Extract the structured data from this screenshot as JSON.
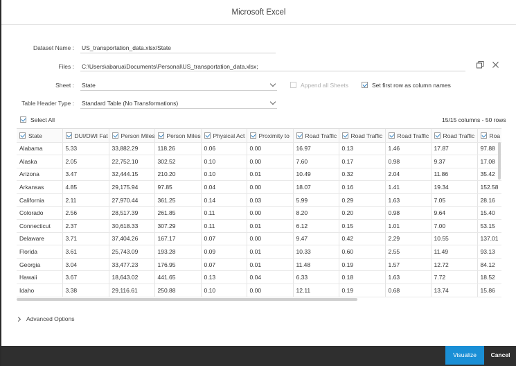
{
  "window": {
    "title": "Microsoft Excel"
  },
  "form": {
    "dataset_label": "Dataset Name :",
    "dataset_value": "US_transportation_data.xlsx/State",
    "files_label": "Files :",
    "files_value": "C:\\Users\\abarua\\Documents\\Personal\\US_transportation_data.xlsx;",
    "sheet_label": "Sheet :",
    "sheet_value": "State",
    "append_label": "Append all Sheets",
    "first_row_label": "Set first row as column names",
    "header_type_label": "Table Header Type :",
    "header_type_value": "Standard Table (No Transformations)"
  },
  "table_controls": {
    "select_all_label": "Select All",
    "count_label": "15/15 columns - 50 rows"
  },
  "table": {
    "columns": [
      "State",
      "DUI/DWI Fat",
      "Person Miles",
      "Person Miles",
      "Physical Act",
      "Proximity to",
      "Road Traffic",
      "Road Traffic",
      "Road Traffic",
      "Road Traffic",
      "Roa"
    ],
    "rows": [
      [
        "Alabama",
        "5.33",
        "33,882.29",
        "118.26",
        "0.06",
        "0.00",
        "16.97",
        "0.13",
        "1.46",
        "17.87",
        "97.88"
      ],
      [
        "Alaska",
        "2.05",
        "22,752.10",
        "302.52",
        "0.10",
        "0.00",
        "7.60",
        "0.17",
        "0.98",
        "9.37",
        "17.08"
      ],
      [
        "Arizona",
        "3.47",
        "32,444.15",
        "210.20",
        "0.10",
        "0.01",
        "10.49",
        "0.32",
        "2.04",
        "11.86",
        "35.42"
      ],
      [
        "Arkansas",
        "4.85",
        "29,175.94",
        "97.85",
        "0.04",
        "0.00",
        "18.07",
        "0.16",
        "1.41",
        "19.34",
        "152.58"
      ],
      [
        "California",
        "2.11",
        "27,970.44",
        "361.25",
        "0.14",
        "0.03",
        "5.99",
        "0.29",
        "1.63",
        "7.05",
        "28.16"
      ],
      [
        "Colorado",
        "2.56",
        "28,517.39",
        "261.85",
        "0.11",
        "0.00",
        "8.20",
        "0.20",
        "0.98",
        "9.64",
        "15.40"
      ],
      [
        "Connecticut",
        "2.37",
        "30,618.33",
        "307.29",
        "0.11",
        "0.01",
        "6.12",
        "0.15",
        "1.01",
        "7.00",
        "53.15"
      ],
      [
        "Delaware",
        "3.71",
        "37,404.26",
        "167.17",
        "0.07",
        "0.00",
        "9.47",
        "0.42",
        "2.29",
        "10.55",
        "137.01"
      ],
      [
        "Florida",
        "3.61",
        "25,743.09",
        "193.28",
        "0.09",
        "0.01",
        "10.33",
        "0.60",
        "2.55",
        "11.49",
        "93.13"
      ],
      [
        "Georgia",
        "3.04",
        "33,477.23",
        "176.95",
        "0.07",
        "0.01",
        "11.48",
        "0.19",
        "1.57",
        "12.72",
        "84.12"
      ],
      [
        "Hawaii",
        "3.67",
        "18,643.02",
        "441.65",
        "0.13",
        "0.04",
        "6.33",
        "0.18",
        "1.63",
        "7.72",
        "18.52"
      ],
      [
        "Idaho",
        "3.38",
        "29,116.61",
        "250.88",
        "0.10",
        "0.00",
        "12.11",
        "0.19",
        "0.68",
        "13.74",
        "15.86"
      ]
    ]
  },
  "advanced": {
    "label": "Advanced Options"
  },
  "footer": {
    "visualize_label": "Visualize",
    "cancel_label": "Cancel"
  },
  "colors": {
    "accent": "#1a8fd6",
    "footer_bg": "#2f2f2f"
  },
  "icons": [
    "copy-icon",
    "close-icon",
    "chevron-down-icon",
    "chevron-right-icon",
    "checkbox-icon"
  ]
}
